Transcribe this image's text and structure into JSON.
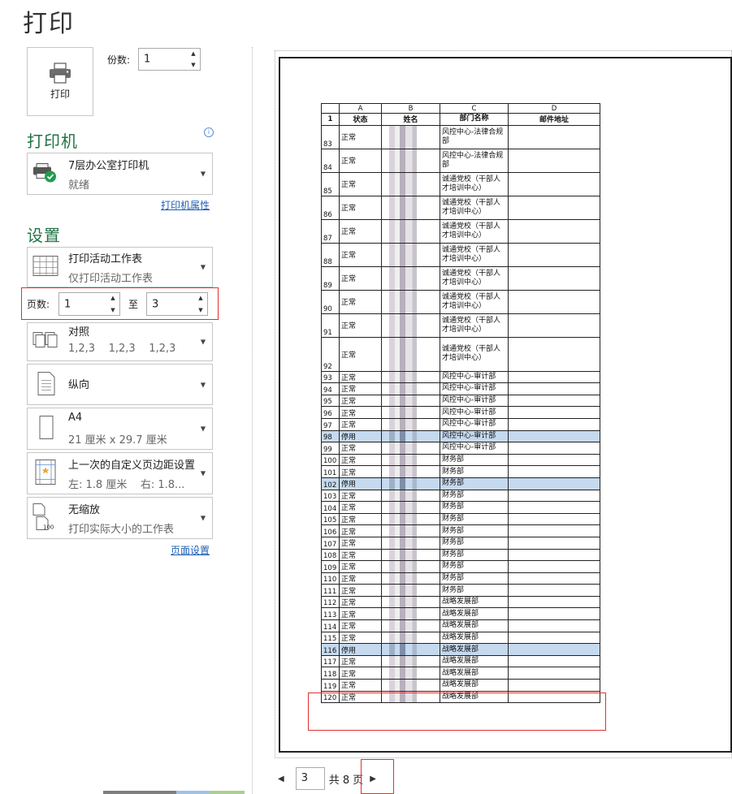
{
  "title": "打印",
  "print_button": {
    "label": "打印"
  },
  "copies": {
    "label": "份数:",
    "value": "1"
  },
  "printer": {
    "heading": "打印机",
    "name": "7层办公室打印机",
    "status": "就绪",
    "properties_link": "打印机属性"
  },
  "settings": {
    "heading": "设置",
    "what": {
      "line1": "打印活动工作表",
      "line2": "仅打印活动工作表"
    },
    "pages": {
      "label": "页数:",
      "from": "1",
      "to_label": "至",
      "to": "3"
    },
    "collate": {
      "line1": "对照",
      "line2": "1,2,3    1,2,3    1,2,3"
    },
    "orientation": {
      "line1": "纵向"
    },
    "paper": {
      "line1": "A4",
      "line2": "21 厘米 x 29.7 厘米"
    },
    "margins": {
      "line1": "上一次的自定义页边距设置",
      "line2": "左: 1.8 厘米    右: 1.8..."
    },
    "scaling": {
      "line1": "无缩放",
      "line2": "打印实际大小的工作表"
    },
    "page_setup_link": "页面设置"
  },
  "sheet": {
    "col_headers": [
      "A",
      "B",
      "C",
      "D"
    ],
    "header_row": {
      "num": "1",
      "cols": [
        "状态",
        "姓名",
        "部门名称",
        "邮件地址"
      ]
    },
    "rows": [
      {
        "num": "83",
        "status": "正常",
        "dept": "风控中心-法律合规部",
        "tall": true
      },
      {
        "num": "84",
        "status": "正常",
        "dept": "风控中心-法律合规部",
        "tall": true
      },
      {
        "num": "85",
        "status": "正常",
        "dept": "诚通党校（干部人才培训中心）",
        "tall": true
      },
      {
        "num": "86",
        "status": "正常",
        "dept": "诚通党校（干部人才培训中心）",
        "tall": true
      },
      {
        "num": "87",
        "status": "正常",
        "dept": "诚通党校（干部人才培训中心）",
        "tall": true
      },
      {
        "num": "88",
        "status": "正常",
        "dept": "诚通党校（干部人才培训中心）",
        "tall": true
      },
      {
        "num": "89",
        "status": "正常",
        "dept": "诚通党校（干部人才培训中心）",
        "tall": true
      },
      {
        "num": "90",
        "status": "正常",
        "dept": "诚通党校（干部人才培训中心）",
        "tall": true
      },
      {
        "num": "91",
        "status": "正常",
        "dept": "诚通党校（干部人才培训中心）",
        "tall": true
      },
      {
        "num": "92",
        "status": "正常",
        "dept": "诚通党校（干部人才培训中心）",
        "tall": true,
        "xtall": true
      },
      {
        "num": "93",
        "status": "正常",
        "dept": "风控中心-审计部"
      },
      {
        "num": "94",
        "status": "正常",
        "dept": "风控中心-审计部"
      },
      {
        "num": "95",
        "status": "正常",
        "dept": "风控中心-审计部"
      },
      {
        "num": "96",
        "status": "正常",
        "dept": "风控中心-审计部"
      },
      {
        "num": "97",
        "status": "正常",
        "dept": "风控中心-审计部"
      },
      {
        "num": "98",
        "status": "停用",
        "dept": "风控中心-审计部",
        "stop": true
      },
      {
        "num": "99",
        "status": "正常",
        "dept": "风控中心-审计部"
      },
      {
        "num": "100",
        "status": "正常",
        "dept": "财务部"
      },
      {
        "num": "101",
        "status": "正常",
        "dept": "财务部"
      },
      {
        "num": "102",
        "status": "停用",
        "dept": "财务部",
        "stop": true
      },
      {
        "num": "103",
        "status": "正常",
        "dept": "财务部"
      },
      {
        "num": "104",
        "status": "正常",
        "dept": "财务部"
      },
      {
        "num": "105",
        "status": "正常",
        "dept": "财务部"
      },
      {
        "num": "106",
        "status": "正常",
        "dept": "财务部"
      },
      {
        "num": "107",
        "status": "正常",
        "dept": "财务部"
      },
      {
        "num": "108",
        "status": "正常",
        "dept": "财务部"
      },
      {
        "num": "109",
        "status": "正常",
        "dept": "财务部"
      },
      {
        "num": "110",
        "status": "正常",
        "dept": "财务部"
      },
      {
        "num": "111",
        "status": "正常",
        "dept": "财务部"
      },
      {
        "num": "112",
        "status": "正常",
        "dept": "战略发展部"
      },
      {
        "num": "113",
        "status": "正常",
        "dept": "战略发展部"
      },
      {
        "num": "114",
        "status": "正常",
        "dept": "战略发展部"
      },
      {
        "num": "115",
        "status": "正常",
        "dept": "战略发展部"
      },
      {
        "num": "116",
        "status": "停用",
        "dept": "战略发展部",
        "stop": true
      },
      {
        "num": "117",
        "status": "正常",
        "dept": "战略发展部"
      },
      {
        "num": "118",
        "status": "正常",
        "dept": "战略发展部"
      },
      {
        "num": "119",
        "status": "正常",
        "dept": "战略发展部"
      },
      {
        "num": "120",
        "status": "正常",
        "dept": "战略发展部"
      }
    ]
  },
  "nav": {
    "current_page": "3",
    "total": "共 8 页"
  },
  "colors": {
    "accent_green": "#217346",
    "highlight": "#e03030",
    "stopped_row": "#c5d9ef",
    "link": "#1f5fb3"
  }
}
